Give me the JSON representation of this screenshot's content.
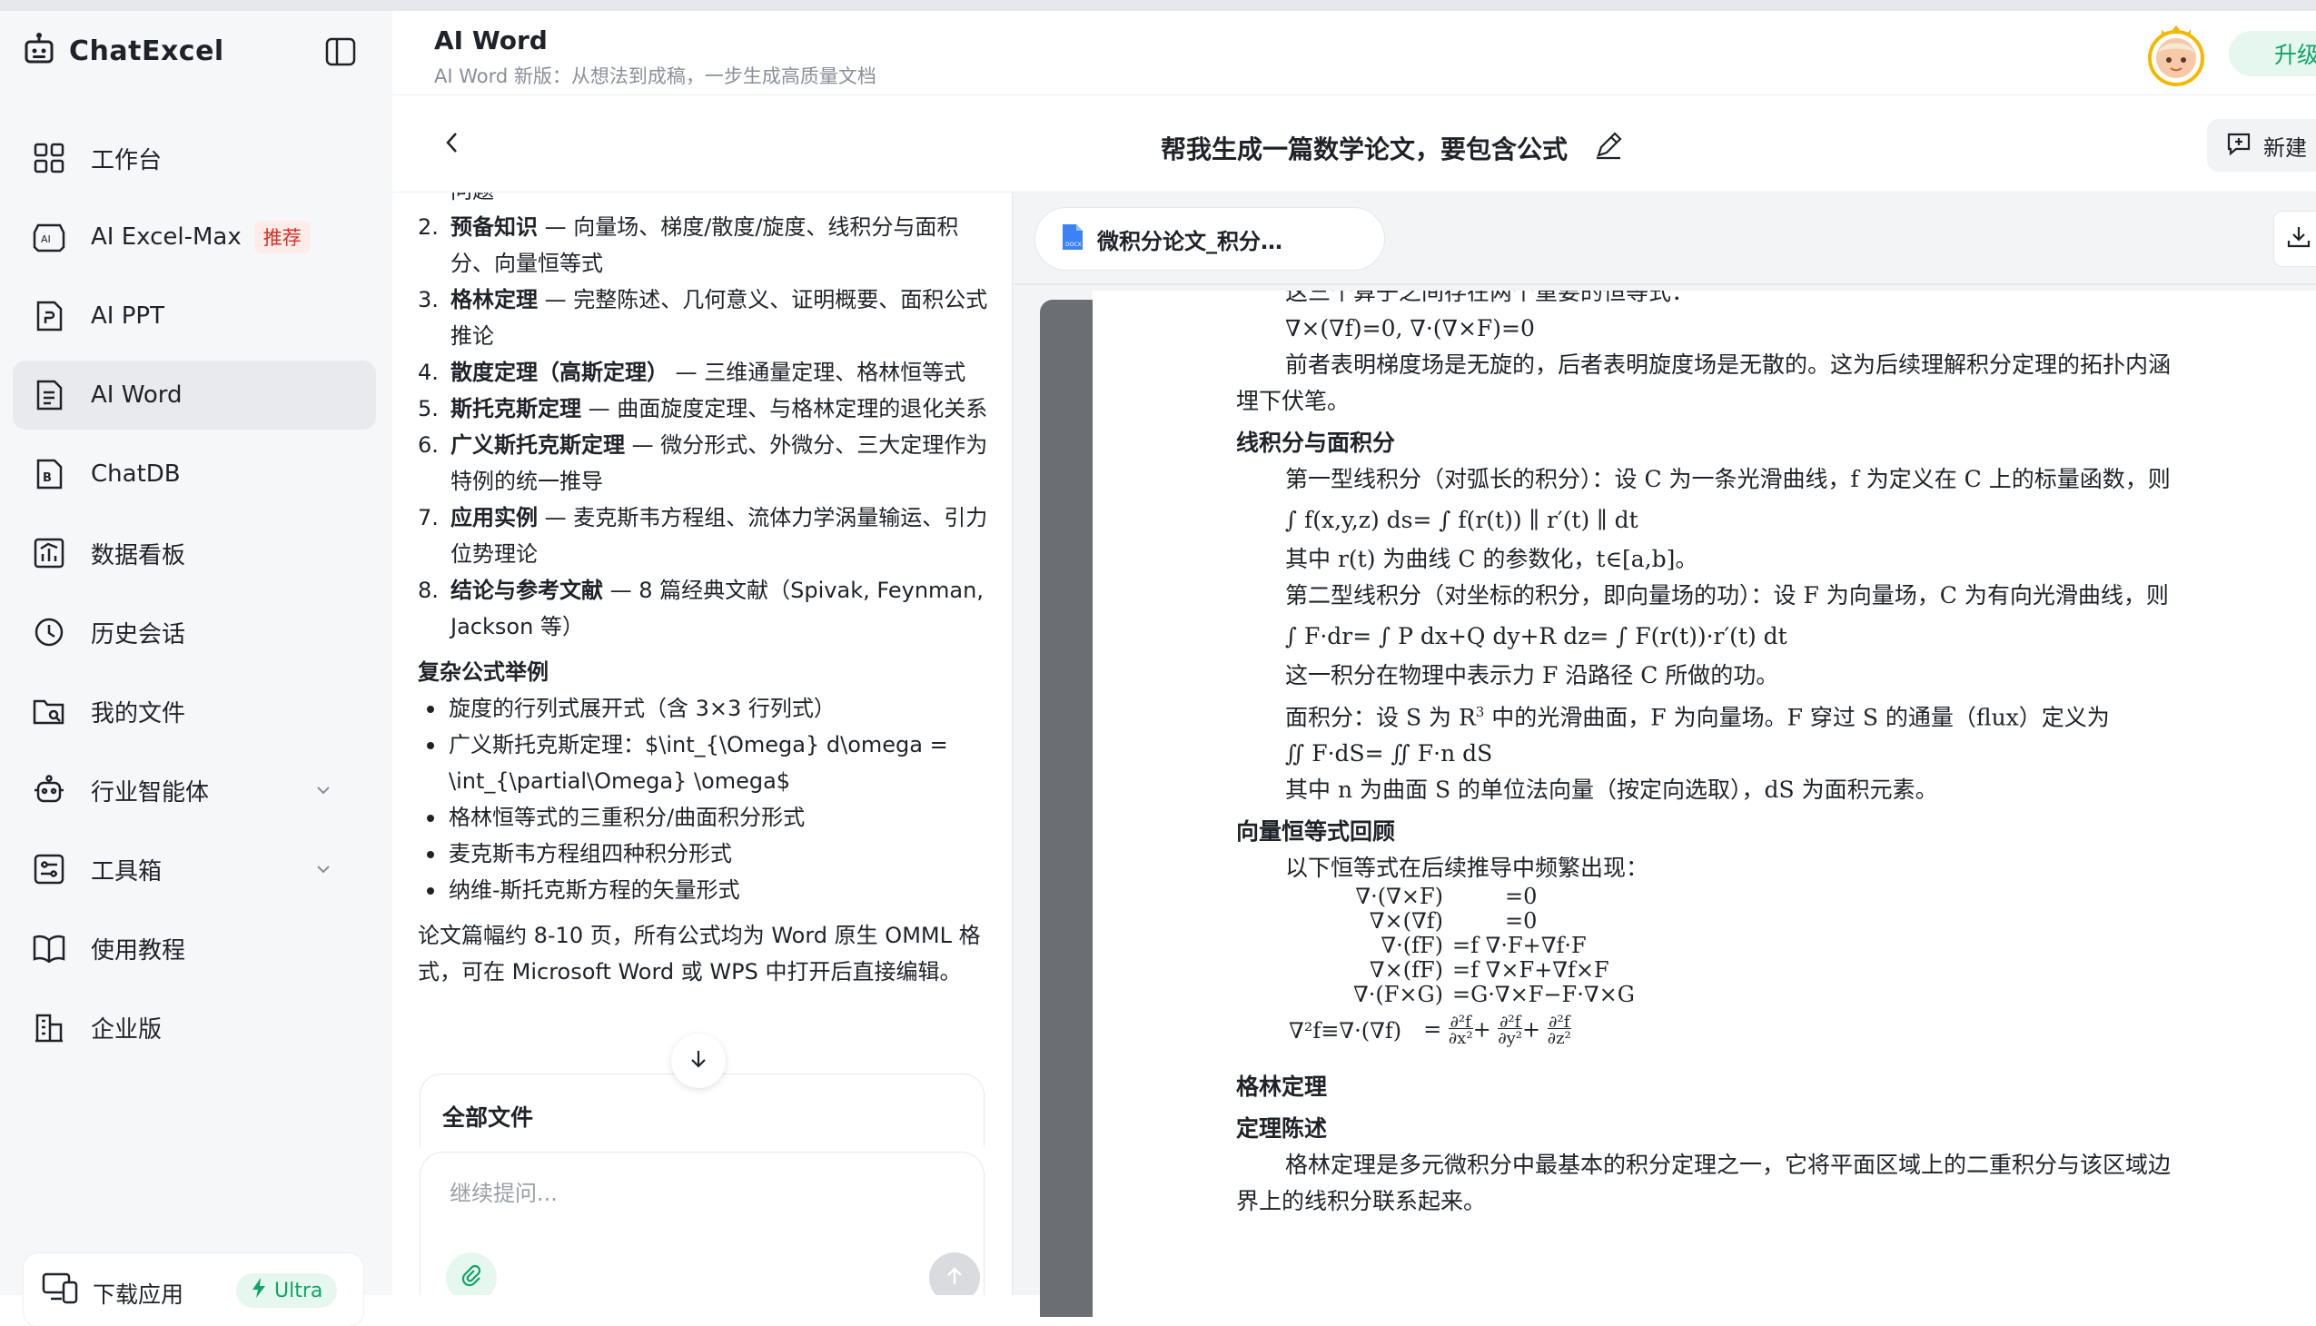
{
  "brand": {
    "name": "ChatExcel"
  },
  "sidebar": {
    "items": [
      {
        "label": "工作台",
        "icon": "grid-icon"
      },
      {
        "label": "AI Excel-Max",
        "icon": "ai-excel-icon",
        "badge": "推荐"
      },
      {
        "label": "AI PPT",
        "icon": "ppt-icon"
      },
      {
        "label": "AI Word",
        "icon": "word-doc-icon",
        "active": true
      },
      {
        "label": "ChatDB",
        "icon": "database-icon"
      },
      {
        "label": "数据看板",
        "icon": "dashboard-icon"
      },
      {
        "label": "历史会话",
        "icon": "history-icon"
      },
      {
        "label": "我的文件",
        "icon": "folder-icon"
      },
      {
        "label": "行业智能体",
        "icon": "robot-icon",
        "expandable": true
      },
      {
        "label": "工具箱",
        "icon": "toolbox-icon",
        "expandable": true
      },
      {
        "label": "使用教程",
        "icon": "book-icon"
      },
      {
        "label": "企业版",
        "icon": "building-icon"
      }
    ],
    "download": {
      "label": "下载应用",
      "badge": "Ultra"
    }
  },
  "header": {
    "title": "AI Word",
    "subtitle": "AI Word 新版：从想法到成稿，一步生成高质量文档",
    "upgrade": "升级"
  },
  "chat": {
    "title": "帮我生成一篇数学论文，要包含公式",
    "new_button": "新建",
    "clipped_top": "问题",
    "outline": [
      {
        "num": "2.",
        "head": "预备知识",
        "text": " — 向量场、梯度/散度/旋度、线积分与面积分、向量恒等式"
      },
      {
        "num": "3.",
        "head": "格林定理",
        "text": " — 完整陈述、几何意义、证明概要、面积公式推论"
      },
      {
        "num": "4.",
        "head": "散度定理（高斯定理）",
        "text": " — 三维通量定理、格林恒等式"
      },
      {
        "num": "5.",
        "head": "斯托克斯定理",
        "text": " — 曲面旋度定理、与格林定理的退化关系"
      },
      {
        "num": "6.",
        "head": "广义斯托克斯定理",
        "text": " — 微分形式、外微分、三大定理作为特例的统一推导"
      },
      {
        "num": "7.",
        "head": "应用实例",
        "text": " — 麦克斯韦方程组、流体力学涡量输运、引力位势理论"
      },
      {
        "num": "8.",
        "head": "结论与参考文献",
        "text": " — 8 篇经典文献（Spivak, Feynman, Jackson 等）"
      }
    ],
    "formula_heading": "复杂公式举例",
    "bullets": [
      "旋度的行列式展开式（含 3×3 行列式）",
      "广义斯托克斯定理：$\\int_{\\Omega} d\\omega = \\int_{\\partial\\Omega} \\omega$",
      "格林恒等式的三重积分/曲面积分形式",
      "麦克斯韦方程组四种积分形式",
      "纳维-斯托克斯方程的矢量形式"
    ],
    "closing": "论文篇幅约 8-10 页，所有公式均为 Word 原生 OMML 格式，可在 Microsoft Word 或 WPS 中打开后直接编辑。",
    "files_label": "全部文件",
    "input_placeholder": "继续提问..."
  },
  "document": {
    "file_tab": "微积分论文_积分…",
    "cut_text": "这三个算子之间存在两个重要的恒等式：",
    "identities_line": "∇×(∇f)=0,       ∇·(∇×F)=0",
    "p1": "前者表明梯度场是无旋的，后者表明旋度场是无散的。这为后续理解积分定理的拓扑内涵埋下伏笔。",
    "h_line": "线积分与面积分",
    "p2": "第一型线积分（对弧长的积分）：设 C 为一条光滑曲线，f 为定义在 C 上的标量函数，则",
    "f1": "∫ f(x,y,z) ds= ∫ f(r(t))  ∥ r′(t) ∥  dt",
    "p3": "其中 r(t) 为曲线 C 的参数化，t∈[a,b]。",
    "p4": "第二型线积分（对坐标的积分，即向量场的功）：设 F 为向量场，C 为有向光滑曲线，则",
    "f2": "∫ F·dr= ∫ P dx+Q dy+R dz= ∫ F(r(t))·r′(t) dt",
    "p5": "这一积分在物理中表示力 F 沿路径 C 所做的功。",
    "p6a": "面积分：设 S 为 R",
    "p6sup": "3",
    "p6b": " 中的光滑曲面，F 为向量场。F 穿过 S 的通量（flux）定义为",
    "f3": "∬ F·dS= ∬ F·n dS",
    "p7": "其中 n 为曲面 S 的单位法向量（按定向选取），dS 为面积元素。",
    "h_vec": "向量恒等式回顾",
    "p8": "以下恒等式在后续推导中频繁出现：",
    "eqs": [
      {
        "lhs": "∇·(∇×F)",
        "rhs": "=0"
      },
      {
        "lhs": "∇×(∇f)",
        "rhs": "=0"
      },
      {
        "lhs": "∇·(fF)",
        "rhs": "=f ∇·F+∇f·F"
      },
      {
        "lhs": "∇×(fF)",
        "rhs": "=f ∇×F+∇f×F"
      },
      {
        "lhs": "∇·(F×G)",
        "rhs": "=G·∇×F−F·∇×G"
      }
    ],
    "lap_lhs": "∇²f≡∇·(∇f)",
    "h_green": "格林定理",
    "h_stmt": "定理陈述",
    "p9": "格林定理是多元微积分中最基本的积分定理之一，它将平面区域上的二重积分与该区域边界上的线积分联系起来。"
  },
  "colors": {
    "accent_green": "#10a36a",
    "badge_red": "#d92d20",
    "active_bg": "#e9eaed"
  }
}
